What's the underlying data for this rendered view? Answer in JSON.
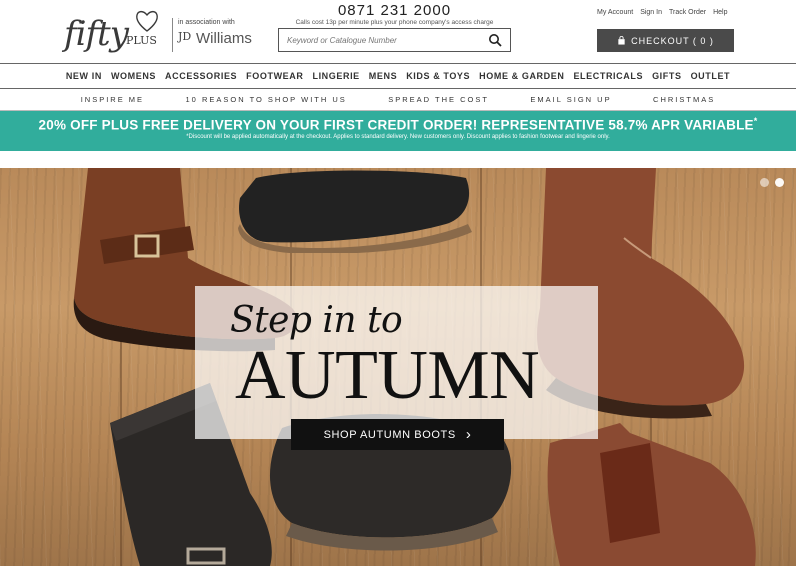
{
  "header": {
    "logo_fifty": "fifty",
    "logo_plus": "PLUS",
    "logo_assoc": "in association with",
    "logo_jd": "JD",
    "logo_williams": "Williams",
    "phone": "0871 231 2000",
    "phone_note": "Calls cost 13p per minute plus your phone company's access charge",
    "search_placeholder": "Keyword or Catalogue Number",
    "links": [
      "My Account",
      "Sign In",
      "Track Order",
      "Help"
    ],
    "checkout_label": "CHECKOUT ( 0 )"
  },
  "main_nav": [
    "NEW IN",
    "WOMENS",
    "ACCESSORIES",
    "FOOTWEAR",
    "LINGERIE",
    "MENS",
    "KIDS & TOYS",
    "HOME & GARDEN",
    "ELECTRICALS",
    "GIFTS",
    "OUTLET"
  ],
  "sub_nav": [
    "INSPIRE ME",
    "10 REASON TO SHOP WITH US",
    "SPREAD THE COST",
    "EMAIL SIGN UP",
    "CHRISTMAS"
  ],
  "promo": {
    "main": "20% OFF PLUS FREE DELIVERY ON YOUR FIRST CREDIT ORDER! REPRESENTATIVE 58.7% APR VARIABLE",
    "asterisk": "*",
    "note": "*Discount will be applied automatically at the checkout. Applies to standard delivery. New customers only. Discount applies to fashion footwear and lingerie only."
  },
  "hero": {
    "script": "Step in to",
    "headline": "AUTUMN",
    "cta": "SHOP AUTUMN BOOTS",
    "cta_arrow": "›"
  },
  "colors": {
    "promo_bg": "#31ad9c",
    "checkout_bg": "#4a4a4a",
    "cta_bg": "#111111"
  }
}
